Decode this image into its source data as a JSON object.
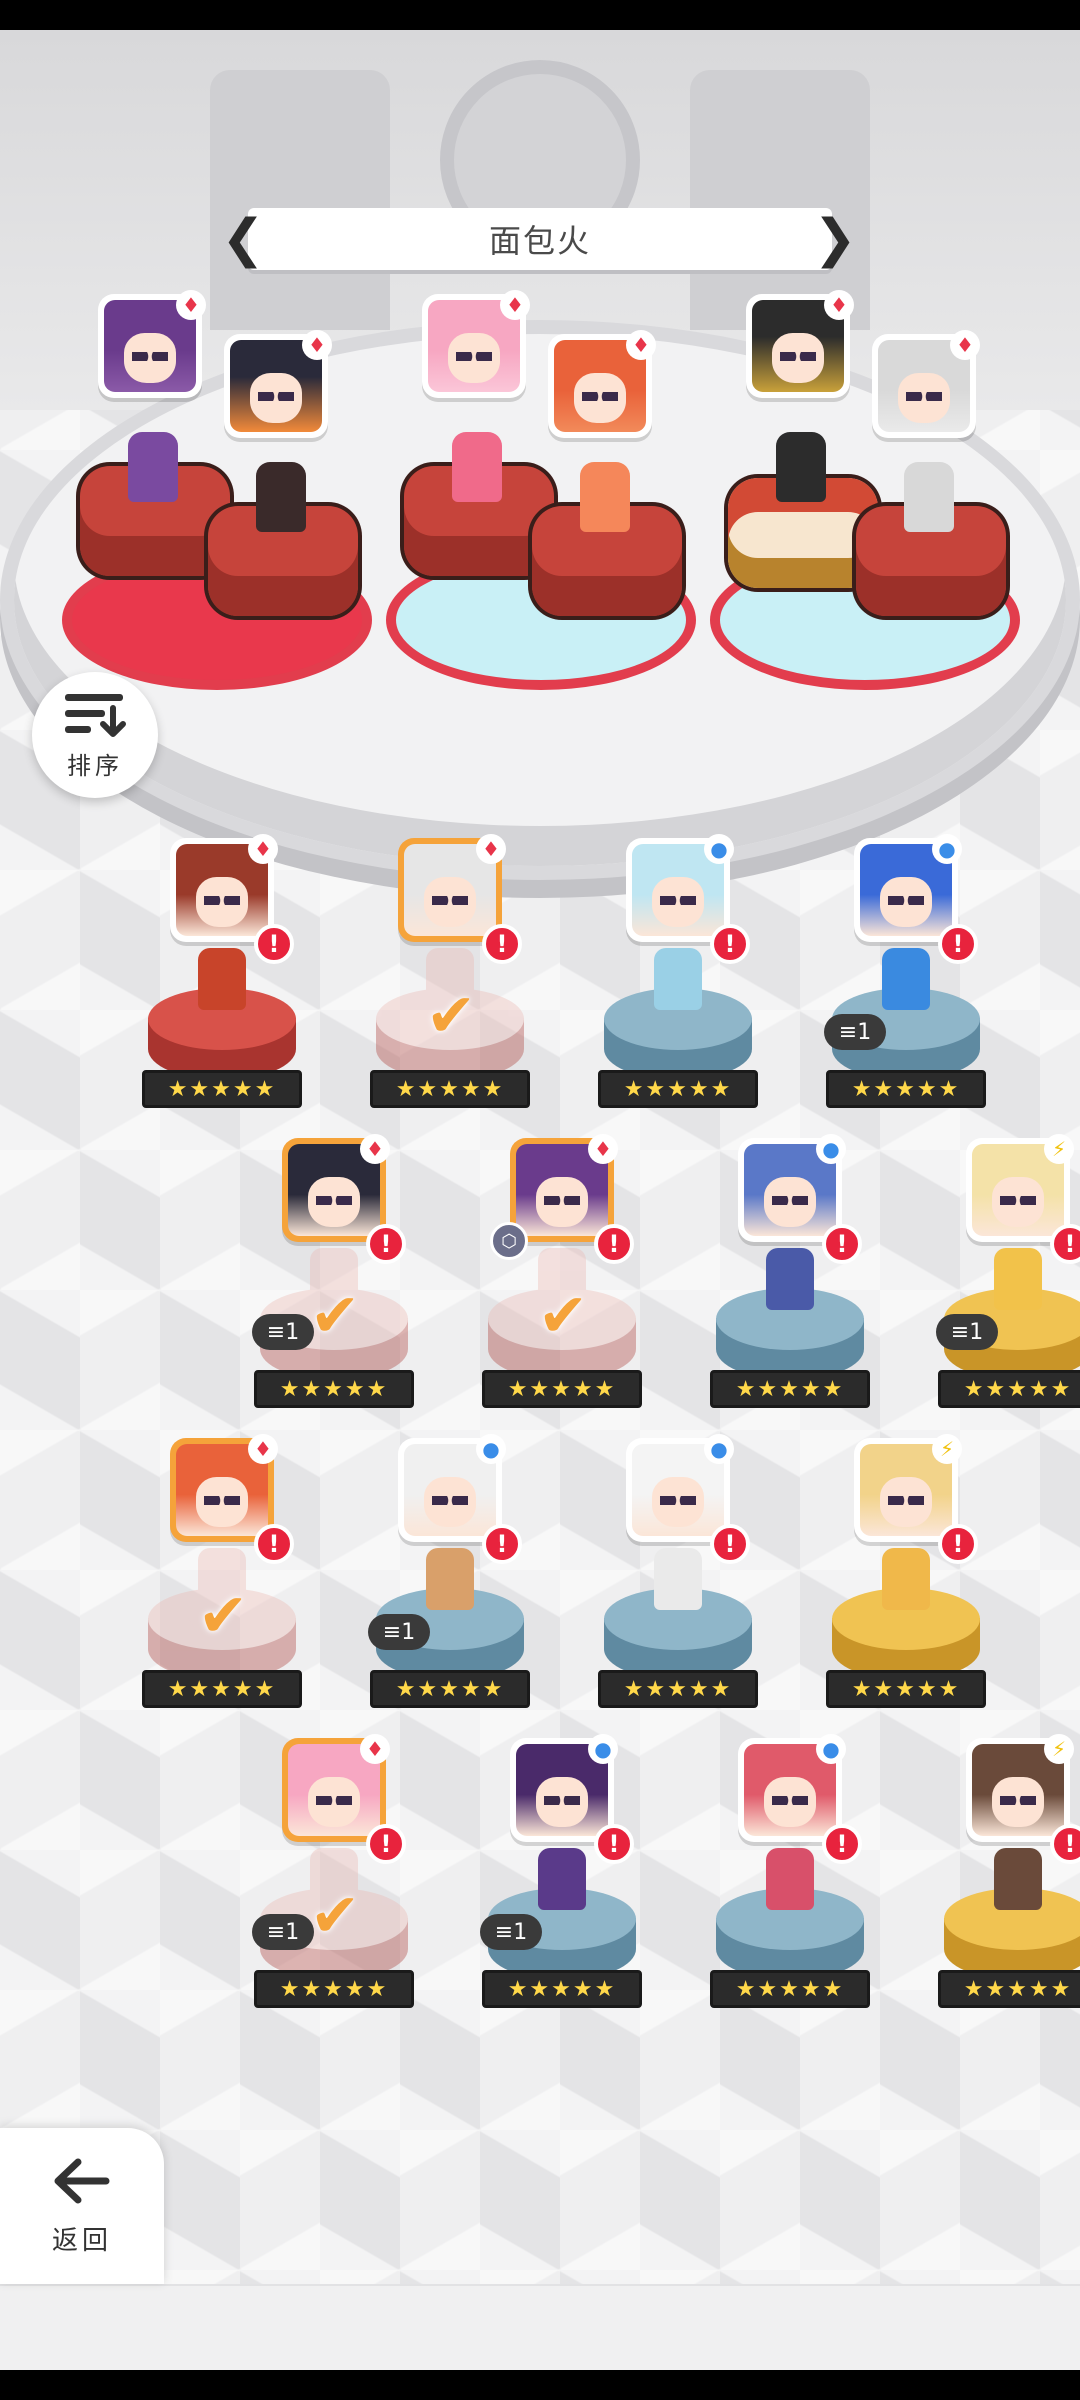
{
  "header": {
    "title": "面包火"
  },
  "controls": {
    "sort_label": "排序",
    "back_label": "返回"
  },
  "rating": "★★★★★",
  "check": "✔",
  "team": [
    {
      "slot": 1,
      "element": "fire",
      "alert": false
    },
    {
      "slot": 2,
      "element": "fire",
      "alert": false
    },
    {
      "slot": 3,
      "element": "fire",
      "alert": false
    },
    {
      "slot": 4,
      "element": "fire",
      "alert": false
    },
    {
      "slot": 5,
      "element": "fire",
      "alert": false
    },
    {
      "slot": 6,
      "element": "fire",
      "alert": false
    }
  ],
  "roster": [
    {
      "element": "fire",
      "selected": false,
      "in_team": false,
      "count": ""
    },
    {
      "element": "fire",
      "selected": true,
      "in_team": true,
      "count": ""
    },
    {
      "element": "water",
      "selected": false,
      "in_team": false,
      "count": ""
    },
    {
      "element": "water",
      "selected": false,
      "in_team": false,
      "count": "1"
    },
    {
      "element": "fire",
      "selected": true,
      "in_team": true,
      "count": "1"
    },
    {
      "element": "fire",
      "selected": true,
      "in_team": true,
      "count": ""
    },
    {
      "element": "water",
      "selected": false,
      "in_team": false,
      "count": ""
    },
    {
      "element": "light",
      "selected": false,
      "in_team": false,
      "count": "1"
    },
    {
      "element": "fire",
      "selected": true,
      "in_team": true,
      "count": ""
    },
    {
      "element": "water",
      "selected": false,
      "in_team": false,
      "count": "1"
    },
    {
      "element": "water",
      "selected": false,
      "in_team": false,
      "count": ""
    },
    {
      "element": "light",
      "selected": false,
      "in_team": false,
      "count": ""
    },
    {
      "element": "fire",
      "selected": true,
      "in_team": true,
      "count": "1"
    },
    {
      "element": "water",
      "selected": false,
      "in_team": false,
      "count": "1"
    },
    {
      "element": "water",
      "selected": false,
      "in_team": false,
      "count": ""
    },
    {
      "element": "light",
      "selected": false,
      "in_team": false,
      "count": ""
    }
  ],
  "badges": {
    "count_1": "1"
  },
  "colors": {
    "fire": "#e8354a",
    "water": "#3a8de8",
    "light": "#f1c20f",
    "selected": "#f5a33a",
    "alert": "#e8233d"
  }
}
